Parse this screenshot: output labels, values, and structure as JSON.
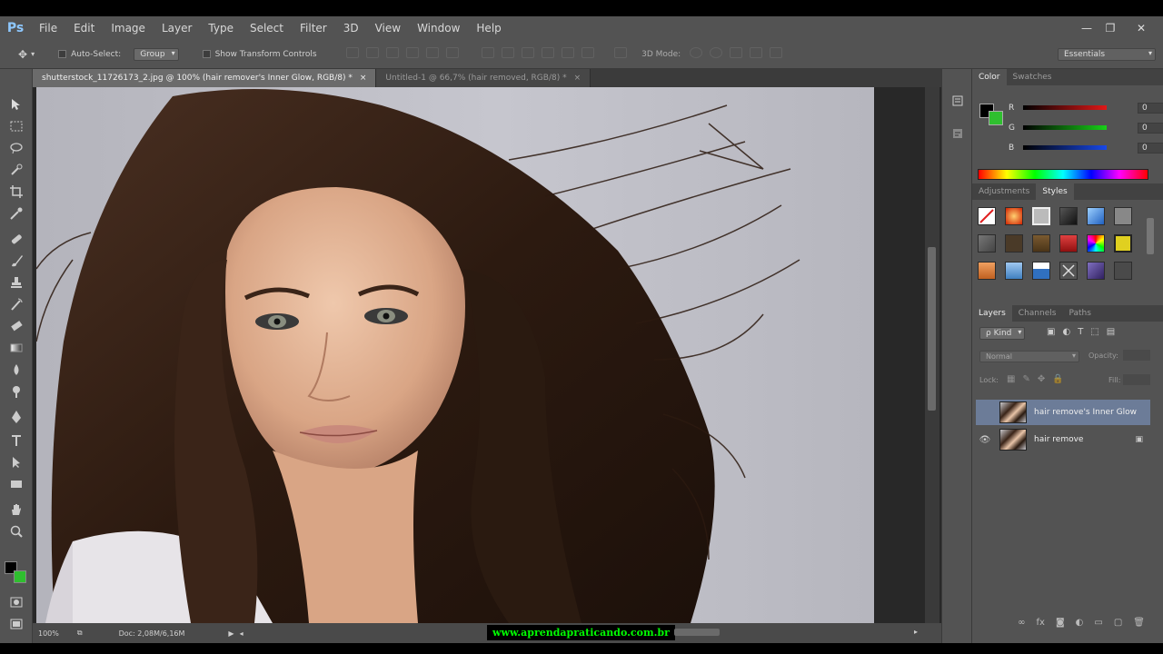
{
  "app": {
    "logo": "Ps"
  },
  "menu": [
    "File",
    "Edit",
    "Image",
    "Layer",
    "Type",
    "Select",
    "Filter",
    "3D",
    "View",
    "Window",
    "Help"
  ],
  "window_controls": {
    "minimize": "—",
    "restore": "❐",
    "close": "✕"
  },
  "options": {
    "auto_select_label": "Auto-Select:",
    "auto_select_value": "Group",
    "show_transform_label": "Show Transform Controls",
    "mode_3d_label": "3D Mode:",
    "workspace": "Essentials"
  },
  "tabs": [
    {
      "label": "shutterstock_11726173_2.jpg @ 100% (hair remover's Inner Glow, RGB/8) *",
      "close": "×"
    },
    {
      "label": "Untitled-1 @ 66,7% (hair removed, RGB/8) *",
      "close": "×"
    }
  ],
  "status": {
    "zoom": "100%",
    "doc": "Doc: 2,08M/6,16M"
  },
  "watermark": "www.aprendapraticando.com.br",
  "color_panel": {
    "tabs": [
      "Color",
      "Swatches"
    ],
    "channels": [
      {
        "label": "R",
        "value": "0",
        "color": "#d01010"
      },
      {
        "label": "G",
        "value": "0",
        "color": "#10c010"
      },
      {
        "label": "B",
        "value": "0",
        "color": "#1040e0"
      }
    ],
    "foreground": "#000000",
    "background": "#2fbf2f"
  },
  "styles_panel": {
    "tabs": [
      "Adjustments",
      "Styles"
    ]
  },
  "layers_panel": {
    "tabs": [
      "Layers",
      "Channels",
      "Paths"
    ],
    "filter_kind": "ρ Kind",
    "blend_mode": "Normal",
    "opacity_label": "Opacity:",
    "lock_label": "Lock:",
    "fill_label": "Fill:",
    "layers": [
      {
        "name": "hair remove's Inner Glow",
        "visible": false,
        "selected": true
      },
      {
        "name": "hair remove",
        "visible": true,
        "selected": false
      }
    ]
  }
}
